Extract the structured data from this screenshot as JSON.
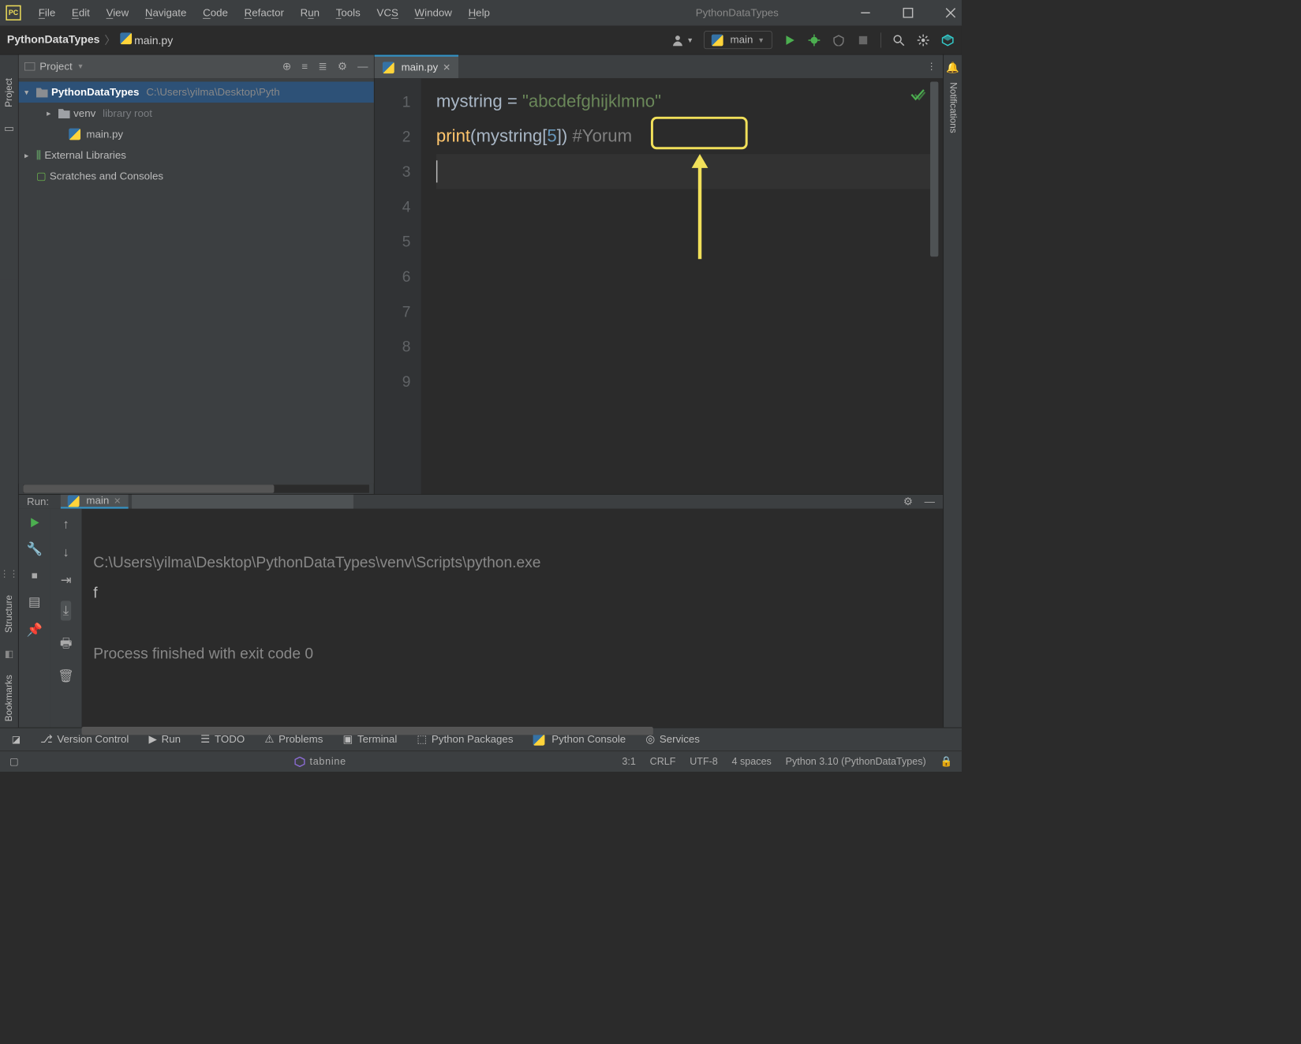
{
  "app_icon_text": "PC",
  "menu": {
    "file": "File",
    "edit": "Edit",
    "view": "View",
    "navigate": "Navigate",
    "code": "Code",
    "refactor": "Refactor",
    "run": "Run",
    "tools": "Tools",
    "vcs": "VCS",
    "window": "Window",
    "help": "Help"
  },
  "window_title": "PythonDataTypes",
  "breadcrumb": {
    "project": "PythonDataTypes",
    "file": "main.py"
  },
  "run_config_label": "main",
  "project_panel": {
    "title": "Project",
    "root_name": "PythonDataTypes",
    "root_path": "C:\\Users\\yilma\\Desktop\\Pyth",
    "venv": "venv",
    "venv_tag": "library root",
    "main_file": "main.py",
    "ext_lib": "External Libraries",
    "scratches": "Scratches and Consoles"
  },
  "editor": {
    "tab_name": "main.py",
    "line_numbers": [
      "1",
      "2",
      "3",
      "4",
      "5",
      "6",
      "7",
      "8",
      "9"
    ],
    "code": {
      "l1_var": "mystring",
      "l1_op": " = ",
      "l1_str": "\"abcdefghijklmno\"",
      "l2_fn": "print",
      "l2_open": "(",
      "l2_arg": "mystring",
      "l2_br": "[",
      "l2_num": "5",
      "l2_br2": "]",
      "l2_close": ")",
      "l2_sp": " ",
      "l2_cm": "#Yorum"
    }
  },
  "run_panel": {
    "label": "Run:",
    "tab": "main",
    "out_lines": [
      "C:\\Users\\yilma\\Desktop\\PythonDataTypes\\venv\\Scripts\\python.exe",
      "f",
      "",
      "Process finished with exit code 0"
    ]
  },
  "sidebar_left": {
    "project": "Project",
    "structure": "Structure",
    "bookmarks": "Bookmarks"
  },
  "sidebar_right": {
    "notifications": "Notifications"
  },
  "bottom1": {
    "vc": "Version Control",
    "run": "Run",
    "todo": "TODO",
    "problems": "Problems",
    "terminal": "Terminal",
    "pkg": "Python Packages",
    "console": "Python Console",
    "services": "Services"
  },
  "bottom2": {
    "brand": "tabnine",
    "pos": "3:1",
    "eol": "CRLF",
    "enc": "UTF-8",
    "indent": "4 spaces",
    "interp": "Python 3.10 (PythonDataTypes)"
  }
}
